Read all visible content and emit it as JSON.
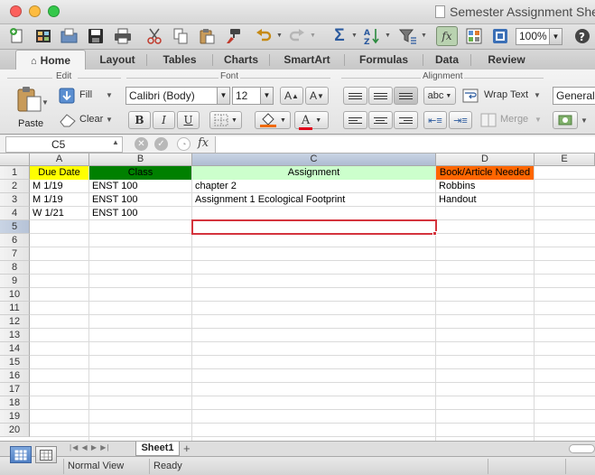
{
  "window": {
    "title": "Semester Assignment She",
    "traffic_colors": {
      "close": "#fc605c",
      "minimize": "#fdbc40",
      "maximize": "#34c84a"
    }
  },
  "toolbar": {
    "zoom": "100%",
    "icons": [
      "new-workbook-icon",
      "templates-icon",
      "open-icon",
      "save-icon",
      "print-icon",
      "cut-icon",
      "copy-icon",
      "paste-icon",
      "format-painter-icon",
      "undo-icon",
      "redo-icon",
      "autosum-icon",
      "sort-icon",
      "filter-icon",
      "formula-builder-icon",
      "gallery-icon",
      "media-icon",
      "help-icon"
    ]
  },
  "ribbon_tabs": [
    {
      "label": "Home",
      "active": true
    },
    {
      "label": "Layout"
    },
    {
      "label": "Tables"
    },
    {
      "label": "Charts"
    },
    {
      "label": "SmartArt"
    },
    {
      "label": "Formulas"
    },
    {
      "label": "Data"
    },
    {
      "label": "Review"
    }
  ],
  "ribbon": {
    "groups": {
      "edit": "Edit",
      "font": "Font",
      "alignment": "Alignment"
    },
    "paste": "Paste",
    "fill": "Fill",
    "clear": "Clear",
    "font_name": "Calibri (Body)",
    "font_size": "12",
    "bold": "B",
    "italic": "I",
    "underline": "U",
    "grow_font": "A",
    "shrink_font": "A",
    "font_color": "A",
    "orientation": "abc",
    "wrap_text": "Wrap Text",
    "merge": "Merge",
    "number_format": "General",
    "colors": {
      "fill_swatch": "#f06a00",
      "font_swatch": "#e0001a"
    }
  },
  "formula_bar": {
    "name_box": "C5",
    "fx": "fx",
    "formula": ""
  },
  "sheet": {
    "columns": [
      "A",
      "B",
      "C",
      "D",
      "E"
    ],
    "selected_column": "C",
    "rows": [
      "1",
      "2",
      "3",
      "4",
      "5",
      "6",
      "7",
      "8",
      "9",
      "10",
      "11",
      "12",
      "13",
      "14",
      "15",
      "16",
      "17",
      "18",
      "19",
      "20"
    ],
    "selected_row": "5",
    "header_row": {
      "due_date": "Due Date",
      "class": "Class",
      "assignment": "Assignment",
      "book": "Book/Article Needed"
    },
    "header_colors": {
      "due_date": "#ffff00",
      "class": "#008000",
      "assignment": "#ccffcc",
      "book": "#ff6600"
    },
    "data_rows": [
      {
        "due_date": "M 1/19",
        "class": "ENST 100",
        "assignment": "chapter 2",
        "book": "Robbins"
      },
      {
        "due_date": "M 1/19",
        "class": "ENST 100",
        "assignment": "Assignment 1 Ecological Footprint",
        "book": "Handout"
      },
      {
        "due_date": "W 1/21",
        "class": "ENST 100",
        "assignment": "",
        "book": ""
      }
    ],
    "selected_cell": "C5",
    "selection_color": "#d4343d"
  },
  "sheet_tabs": [
    {
      "label": "Sheet1",
      "active": true
    }
  ],
  "status": {
    "view": "Normal View",
    "state": "Ready"
  }
}
